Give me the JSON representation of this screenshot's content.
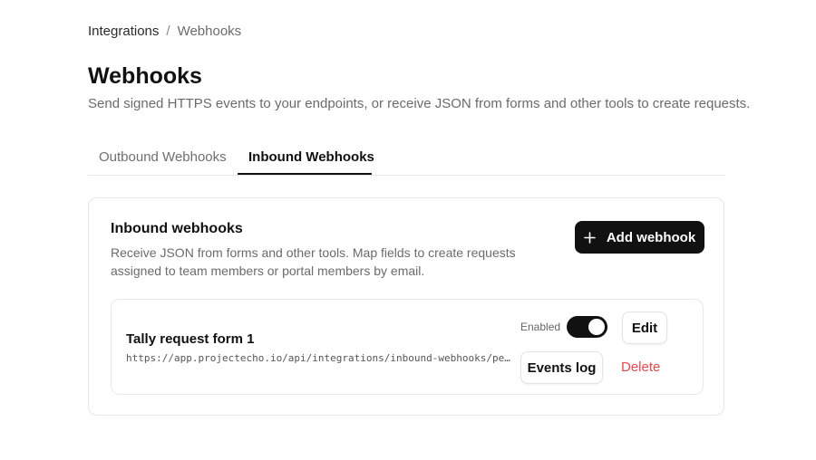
{
  "breadcrumb": {
    "parent": "Integrations",
    "separator": "/",
    "current": "Webhooks"
  },
  "page": {
    "title": "Webhooks",
    "subtitle": "Send signed HTTPS events to your endpoints, or receive JSON from forms and other tools to create requests."
  },
  "tabs": [
    {
      "label": "Outbound Webhooks",
      "active": false
    },
    {
      "label": "Inbound Webhooks",
      "active": true
    }
  ],
  "card": {
    "title": "Inbound webhooks",
    "description": "Receive JSON from forms and other tools. Map fields to create requests assigned to team members or portal members by email.",
    "add_button": {
      "label": "Add webhook",
      "icon": "plus-icon"
    }
  },
  "webhooks": [
    {
      "name": "Tally request form 1",
      "url": "https://app.projectecho.io/api/integrations/inbound-webhooks/pe…",
      "enabled_label": "Enabled",
      "enabled": true,
      "edit_label": "Edit",
      "events_label": "Events log",
      "delete_label": "Delete"
    }
  ],
  "colors": {
    "primary": "#111111",
    "danger": "#e5484d",
    "muted": "#6b6b6b",
    "border": "#e5e5e5"
  }
}
